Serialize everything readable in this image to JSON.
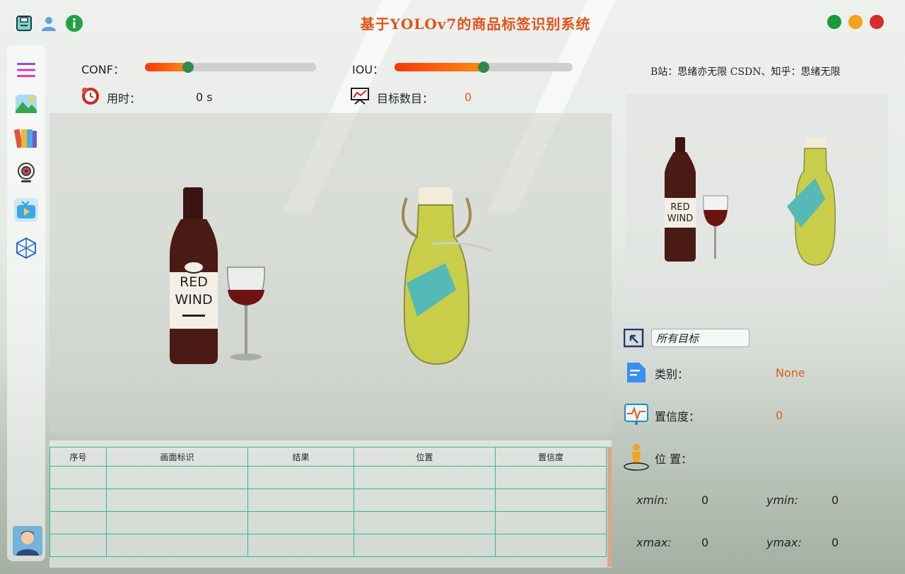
{
  "window": {
    "title": "基于YOLOv7的商品标签识别系统",
    "controls": [
      {
        "name": "maximize",
        "color": "#1a9a3a"
      },
      {
        "name": "minimize",
        "color": "#f3a21b"
      },
      {
        "name": "close",
        "color": "#d92b2b"
      }
    ],
    "top_icons": [
      "save-icon",
      "user-icon",
      "info-icon"
    ]
  },
  "sidebar": {
    "items": [
      {
        "icon": "menu-icon"
      },
      {
        "icon": "image-icon"
      },
      {
        "icon": "folder-icon"
      },
      {
        "icon": "camera-icon"
      },
      {
        "icon": "video-icon"
      },
      {
        "icon": "model-icon"
      }
    ],
    "avatar": "avatar"
  },
  "controls": {
    "conf_label": "CONF：",
    "conf_value": 0.25,
    "iou_label": "IOU：",
    "iou_value": 0.5,
    "time_label": "用时：",
    "time_value": "0 s",
    "count_label": "目标数目：",
    "count_value": "0"
  },
  "credits": "B站：思绪亦无限  CSDN、知乎：思绪无限",
  "main_image": {
    "bottle_label_line1": "RED",
    "bottle_label_line2": "WIND"
  },
  "table": {
    "headers": [
      "序号",
      "画面标识",
      "结果",
      "位置",
      "置信度"
    ],
    "rows": [
      [
        "",
        "",
        "",
        "",
        ""
      ],
      [
        "",
        "",
        "",
        "",
        ""
      ],
      [
        "",
        "",
        "",
        "",
        ""
      ],
      [
        "",
        "",
        "",
        "",
        ""
      ]
    ]
  },
  "detail": {
    "target_select": "所有目标",
    "class_label": "类别：",
    "class_value": "None",
    "conf_label": "置信度：",
    "conf_value": "0",
    "pos_label": "位 置：",
    "xmin_label": "xmin:",
    "xmin_value": "0",
    "ymin_label": "ymin:",
    "ymin_value": "0",
    "xmax_label": "xmax:",
    "xmax_value": "0",
    "ymax_label": "ymax:",
    "ymax_value": "0"
  },
  "colors": {
    "accent": "#e2531a",
    "slider_knob": "#2f8a4f",
    "table_border": "#2bbf8d"
  }
}
